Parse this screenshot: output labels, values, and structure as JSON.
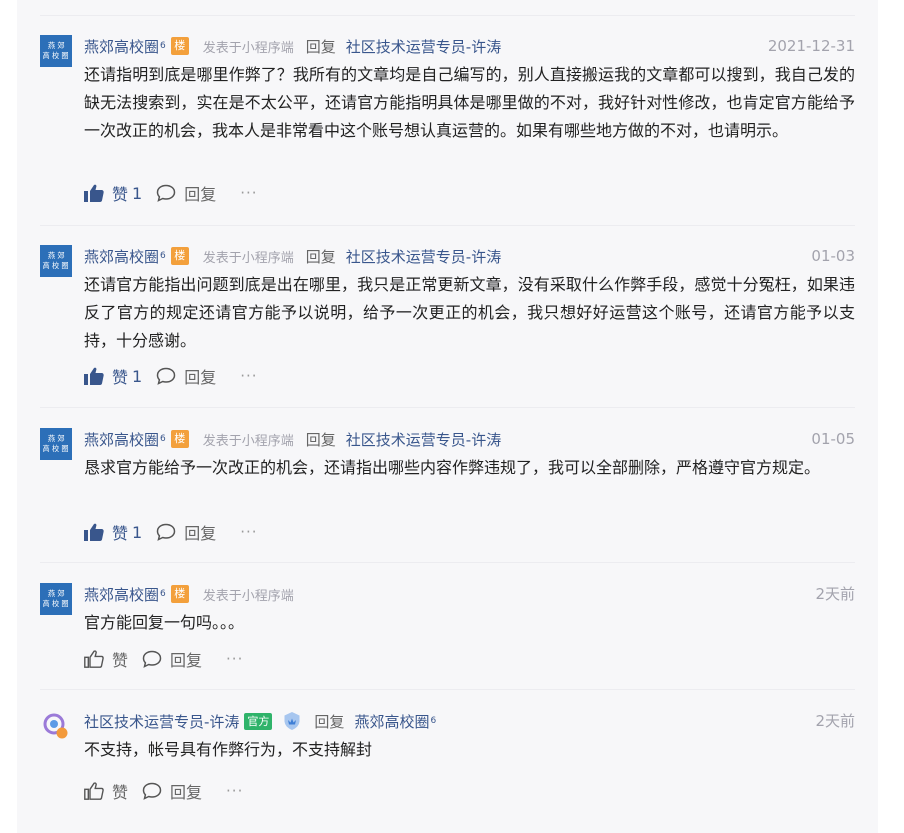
{
  "comments": [
    {
      "author": "燕郊高校圈",
      "level": "6",
      "floor_badge": "楼",
      "via": "发表于小程序端",
      "reply_word": "回复",
      "reply_to": "社区技术运营专员-许涛",
      "date": "2021-12-31",
      "text": "还请指明到底是哪里作弊了？我所有的文章均是自己编写的，别人直接搬运我的文章都可以搜到，我自己发的缺无法搜索到，实在是不太公平，还请官方能指明具体是哪里做的不对，我好针对性修改，也肯定官方能给予一次改正的机会，我本人是非常看中这个账号想认真运营的。如果有哪些地方做的不对，也请明示。",
      "like_label": "赞",
      "like_count": "1",
      "reply_label": "回复",
      "more": "···",
      "liked": true
    },
    {
      "author": "燕郊高校圈",
      "level": "6",
      "floor_badge": "楼",
      "via": "发表于小程序端",
      "reply_word": "回复",
      "reply_to": "社区技术运营专员-许涛",
      "date": "01-03",
      "text": "还请官方能指出问题到底是出在哪里，我只是正常更新文章，没有采取什么作弊手段，感觉十分冤枉，如果违反了官方的规定还请官方能予以说明，给予一次更正的机会，我只想好好运营这个账号，还请官方能予以支持，十分感谢。",
      "like_label": "赞",
      "like_count": "1",
      "reply_label": "回复",
      "more": "···",
      "liked": true
    },
    {
      "author": "燕郊高校圈",
      "level": "6",
      "floor_badge": "楼",
      "via": "发表于小程序端",
      "reply_word": "回复",
      "reply_to": "社区技术运营专员-许涛",
      "date": "01-05",
      "text": "恳求官方能给予一次改正的机会，还请指出哪些内容作弊违规了，我可以全部删除，严格遵守官方规定。",
      "like_label": "赞",
      "like_count": "1",
      "reply_label": "回复",
      "more": "···",
      "liked": true
    },
    {
      "author": "燕郊高校圈",
      "level": "6",
      "floor_badge": "楼",
      "via": "发表于小程序端",
      "date": "2天前",
      "text": "官方能回复一句吗。。。",
      "like_label": "赞",
      "reply_label": "回复",
      "more": "···",
      "liked": false
    },
    {
      "author": "社区技术运营专员-许涛",
      "official_badge": "官方",
      "reply_word": "回复",
      "reply_to": "燕郊高校圈",
      "reply_to_level": "6",
      "date": "2天前",
      "text": "不支持，帐号具有作弊行为，不支持解封",
      "like_label": "赞",
      "reply_label": "回复",
      "more": "···",
      "liked": false
    }
  ],
  "avatar_text": [
    "燕 郊",
    "高 校 圈"
  ],
  "colors": {
    "accent": "#39568c",
    "muted": "#a3a3ad",
    "floor_badge": "#f3a03c",
    "official_badge": "#2fb36a"
  }
}
